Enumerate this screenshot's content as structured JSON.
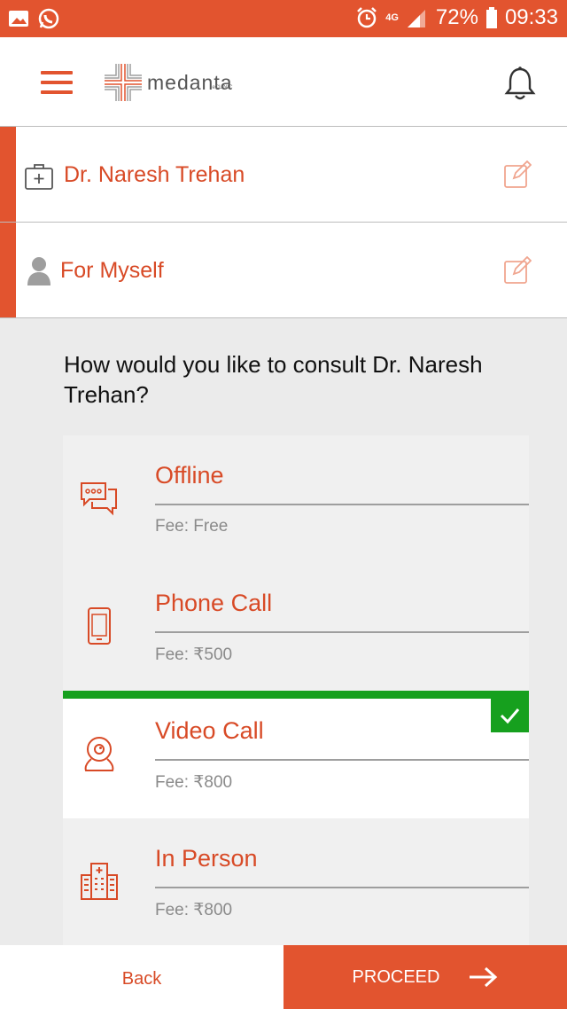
{
  "status_bar": {
    "battery": "72%",
    "time": "09:33",
    "network": "4G"
  },
  "header": {
    "logo_text": "medanta",
    "logo_sub": "eCLINIC"
  },
  "doctor_row": {
    "label": "Dr. Naresh Trehan"
  },
  "patient_row": {
    "label": "For Myself"
  },
  "question": "How would you like to consult Dr. Naresh Trehan?",
  "options": [
    {
      "title": "Offline",
      "fee": "Fee: Free",
      "icon": "chat-bubbles-icon",
      "selected": false
    },
    {
      "title": "Phone Call",
      "fee": "Fee: ₹500",
      "icon": "mobile-phone-icon",
      "selected": false
    },
    {
      "title": "Video Call",
      "fee": "Fee: ₹800",
      "icon": "webcam-icon",
      "selected": true
    },
    {
      "title": "In Person",
      "fee": "Fee: ₹800",
      "icon": "hospital-building-icon",
      "selected": false
    }
  ],
  "footer": {
    "back_label": "Back",
    "proceed_label": "PROCEED"
  },
  "colors": {
    "accent": "#e2542f",
    "selected": "#16a01e"
  }
}
